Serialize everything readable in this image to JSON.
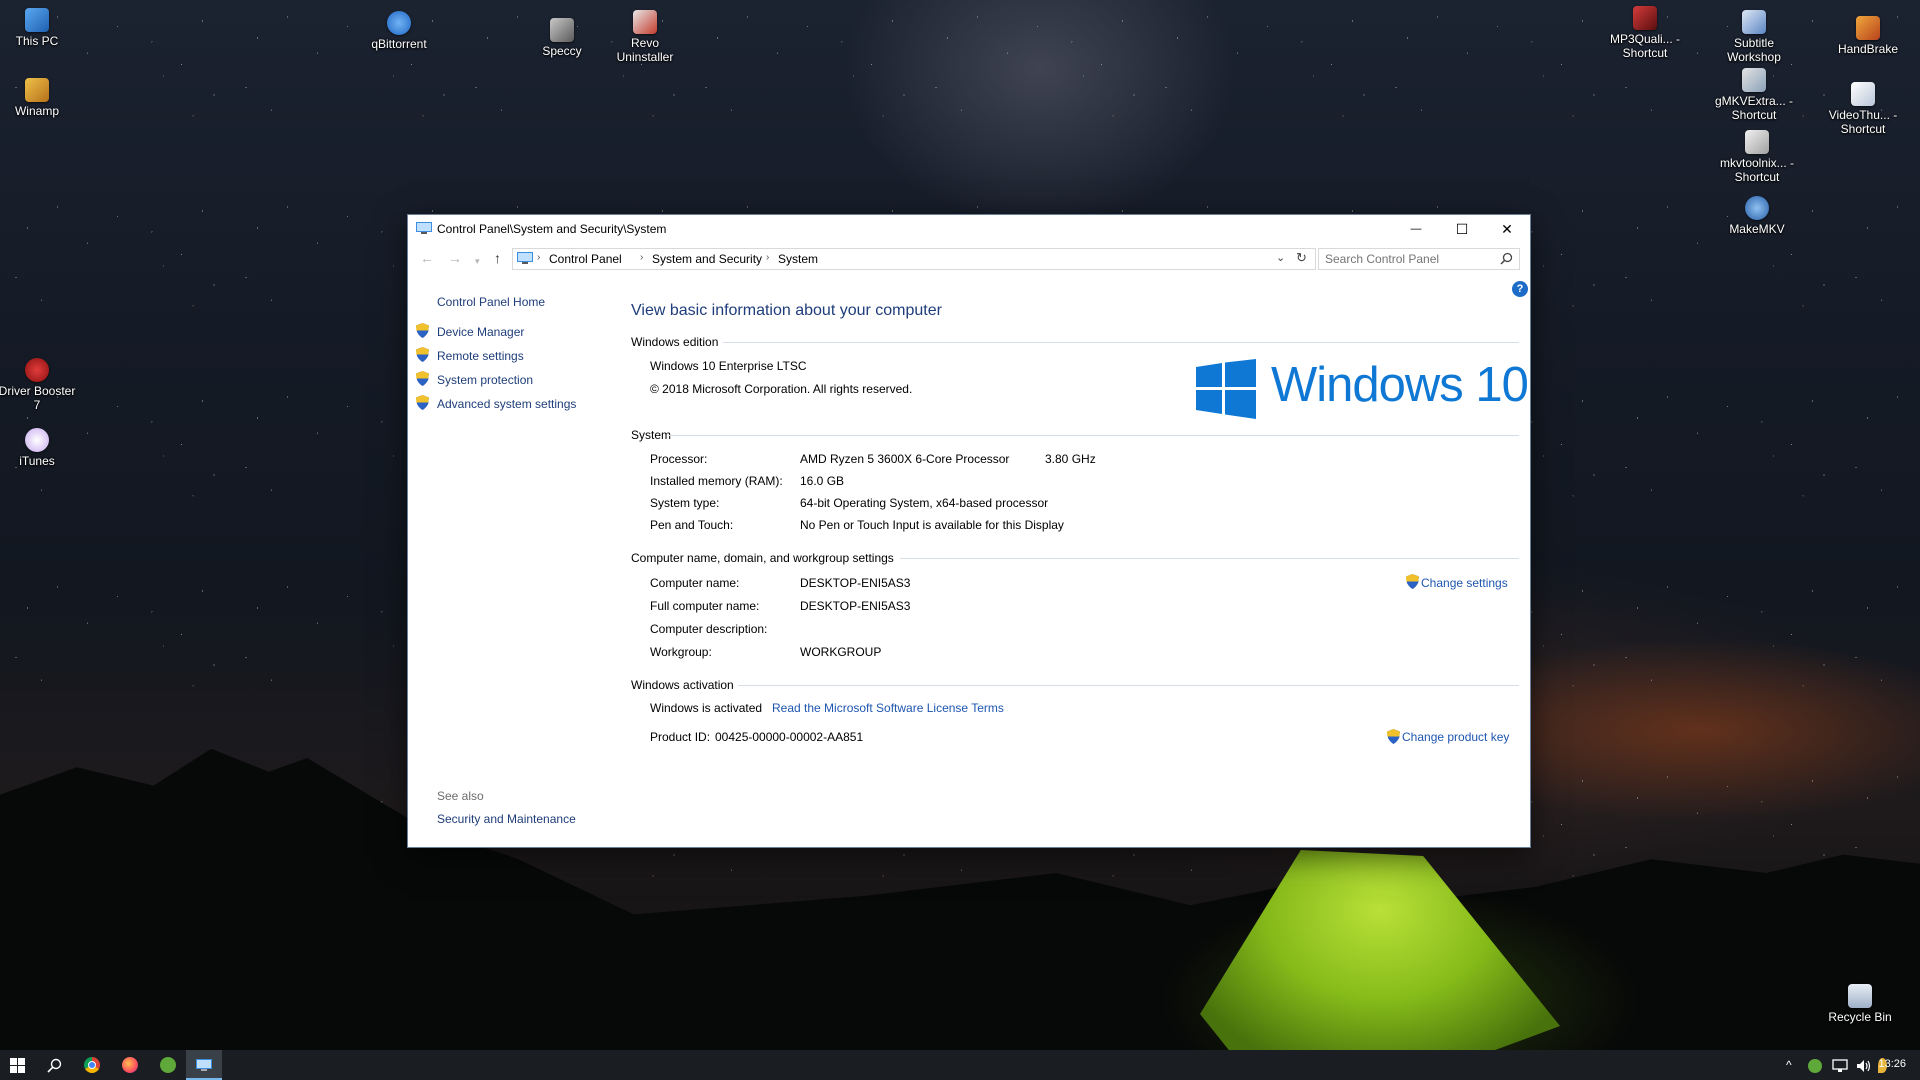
{
  "desktop": {
    "icons": [
      {
        "label": "This PC"
      },
      {
        "label": "Winamp"
      },
      {
        "label": "Driver Booster 7"
      },
      {
        "label": "iTunes"
      },
      {
        "label": "qBittorrent"
      },
      {
        "label": "Speccy"
      },
      {
        "label": "Revo Uninstaller"
      },
      {
        "label": "MP3Quali... - Shortcut"
      },
      {
        "label": "Subtitle Workshop"
      },
      {
        "label": "HandBrake"
      },
      {
        "label": "gMKVExtra... - Shortcut"
      },
      {
        "label": "VideoThu... - Shortcut"
      },
      {
        "label": "mkvtoolnix... - Shortcut"
      },
      {
        "label": "MakeMKV"
      },
      {
        "label": "Recycle Bin"
      }
    ]
  },
  "window": {
    "title": "Control Panel\\System and Security\\System",
    "controls": {
      "minimize": "—",
      "maximize": "☐",
      "close": "✕"
    },
    "address": {
      "breadcrumbs": [
        "Control Panel",
        "System and Security",
        "System"
      ],
      "search_placeholder": "Search Control Panel"
    },
    "left_pane": {
      "home": "Control Panel Home",
      "links": [
        "Device Manager",
        "Remote settings",
        "System protection",
        "Advanced system settings"
      ],
      "see_also_label": "See also",
      "see_also_links": [
        "Security and Maintenance"
      ]
    },
    "main": {
      "title": "View basic information about your computer",
      "edition": {
        "heading": "Windows edition",
        "name": "Windows 10 Enterprise LTSC",
        "copyright": "© 2018 Microsoft Corporation. All rights reserved.",
        "logo_text": "Windows 10"
      },
      "system": {
        "heading": "System",
        "rows": [
          {
            "label": "Processor:",
            "value": "AMD Ryzen 5 3600X 6-Core Processor",
            "extra": "3.80 GHz"
          },
          {
            "label": "Installed memory (RAM):",
            "value": "16.0 GB"
          },
          {
            "label": "System type:",
            "value": "64-bit Operating System, x64-based processor"
          },
          {
            "label": "Pen and Touch:",
            "value": "No Pen or Touch Input is available for this Display"
          }
        ]
      },
      "computer": {
        "heading": "Computer name, domain, and workgroup settings",
        "change_settings": "Change settings",
        "rows": [
          {
            "label": "Computer name:",
            "value": "DESKTOP-ENI5AS3"
          },
          {
            "label": "Full computer name:",
            "value": "DESKTOP-ENI5AS3"
          },
          {
            "label": "Computer description:",
            "value": ""
          },
          {
            "label": "Workgroup:",
            "value": "WORKGROUP"
          }
        ]
      },
      "activation": {
        "heading": "Windows activation",
        "status": "Windows is activated",
        "license_link": "Read the Microsoft Software License Terms",
        "product_id_label": "Product ID:",
        "product_id": "00425-00000-00002-AA851",
        "change_key": "Change product key"
      }
    }
  },
  "taskbar": {
    "time": "13:26",
    "tray_chevron": "^"
  },
  "colors": {
    "link": "#1e56b0",
    "title_blue": "#1e3d7a",
    "windows_blue": "#0f78d4"
  }
}
